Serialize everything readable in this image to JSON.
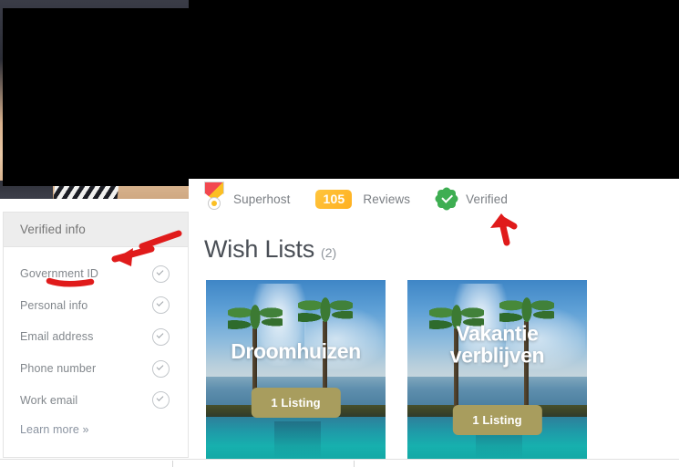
{
  "profile_photo": {
    "alt": "profile-photo-redacted",
    "redacted": true,
    "redaction_color": "#000000"
  },
  "verified_info_card": {
    "header_title": "Verified info",
    "items": [
      {
        "label": "Government ID",
        "icon": "check-circle-icon",
        "verified": true
      },
      {
        "label": "Personal info",
        "icon": "check-circle-icon",
        "verified": true
      },
      {
        "label": "Email address",
        "icon": "check-circle-icon",
        "verified": true
      },
      {
        "label": "Phone number",
        "icon": "check-circle-icon",
        "verified": true
      },
      {
        "label": "Work email",
        "icon": "check-circle-icon",
        "verified": true
      }
    ],
    "learn_more_label": "Learn more »",
    "header_bg": "#ededed",
    "border_color": "#e4e4e4"
  },
  "status_row": {
    "superhost": {
      "icon": "superhost-medal-icon",
      "label": "Superhost"
    },
    "reviews": {
      "count": "105",
      "label": "Reviews",
      "badge_color": "#ffb020"
    },
    "verified": {
      "icon": "verified-green-badge-icon",
      "label": "Verified",
      "badge_color": "#3eae52"
    }
  },
  "wish_lists": {
    "title": "Wish Lists",
    "count_label": "(2)",
    "cards": [
      {
        "title": "Droomhuizen",
        "title_lines": [
          "Droomhuizen"
        ],
        "listing_badge": "1 Listing",
        "badge_color": "#a89d5e",
        "image_alt": "tropical-infinity-pool-with-palm-trees"
      },
      {
        "title": "Vakantie verblijven",
        "title_lines": [
          "Vakantie",
          "verblijven"
        ],
        "listing_badge": "1 Listing",
        "badge_color": "#a89d5e",
        "image_alt": "tropical-infinity-pool-with-palm-trees"
      }
    ]
  },
  "annotations": {
    "color": "#e01b1b",
    "marks": [
      {
        "name": "arrow-pointing-to-verified-info",
        "type": "arrow",
        "direction": "down-left"
      },
      {
        "name": "underline-under-government-id",
        "type": "underline"
      },
      {
        "name": "arrow-pointing-to-verified-badge",
        "type": "arrow",
        "direction": "up"
      }
    ]
  }
}
